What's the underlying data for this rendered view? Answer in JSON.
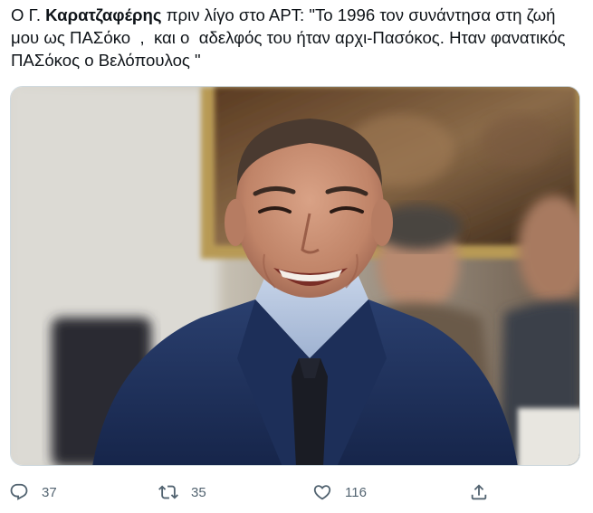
{
  "tweet": {
    "text_prefix": "Ο Γ. ",
    "text_bold": "Καρατζαφέρης",
    "text_rest": " πριν λίγο στο ΑΡΤ: \"Το 1996 τον συνάντησα στη ζωή μου ως ΠΑΣόκο  ,  και ο  αδελφός του ήταν αρχι-Πασόκος. Ηταν φανατικός ΠΑΣόκος ο Βελόπουλος \""
  },
  "media": {
    "icon": "photo-of-smiling-man-in-suit"
  },
  "actions": {
    "reply_count": "37",
    "retweet_count": "35",
    "like_count": "116",
    "reply_icon": "reply-icon",
    "retweet_icon": "retweet-icon",
    "like_icon": "heart-icon",
    "share_icon": "share-icon"
  },
  "colors": {
    "text": "#0f1419",
    "secondary": "#536471",
    "border": "#cfd9de"
  }
}
